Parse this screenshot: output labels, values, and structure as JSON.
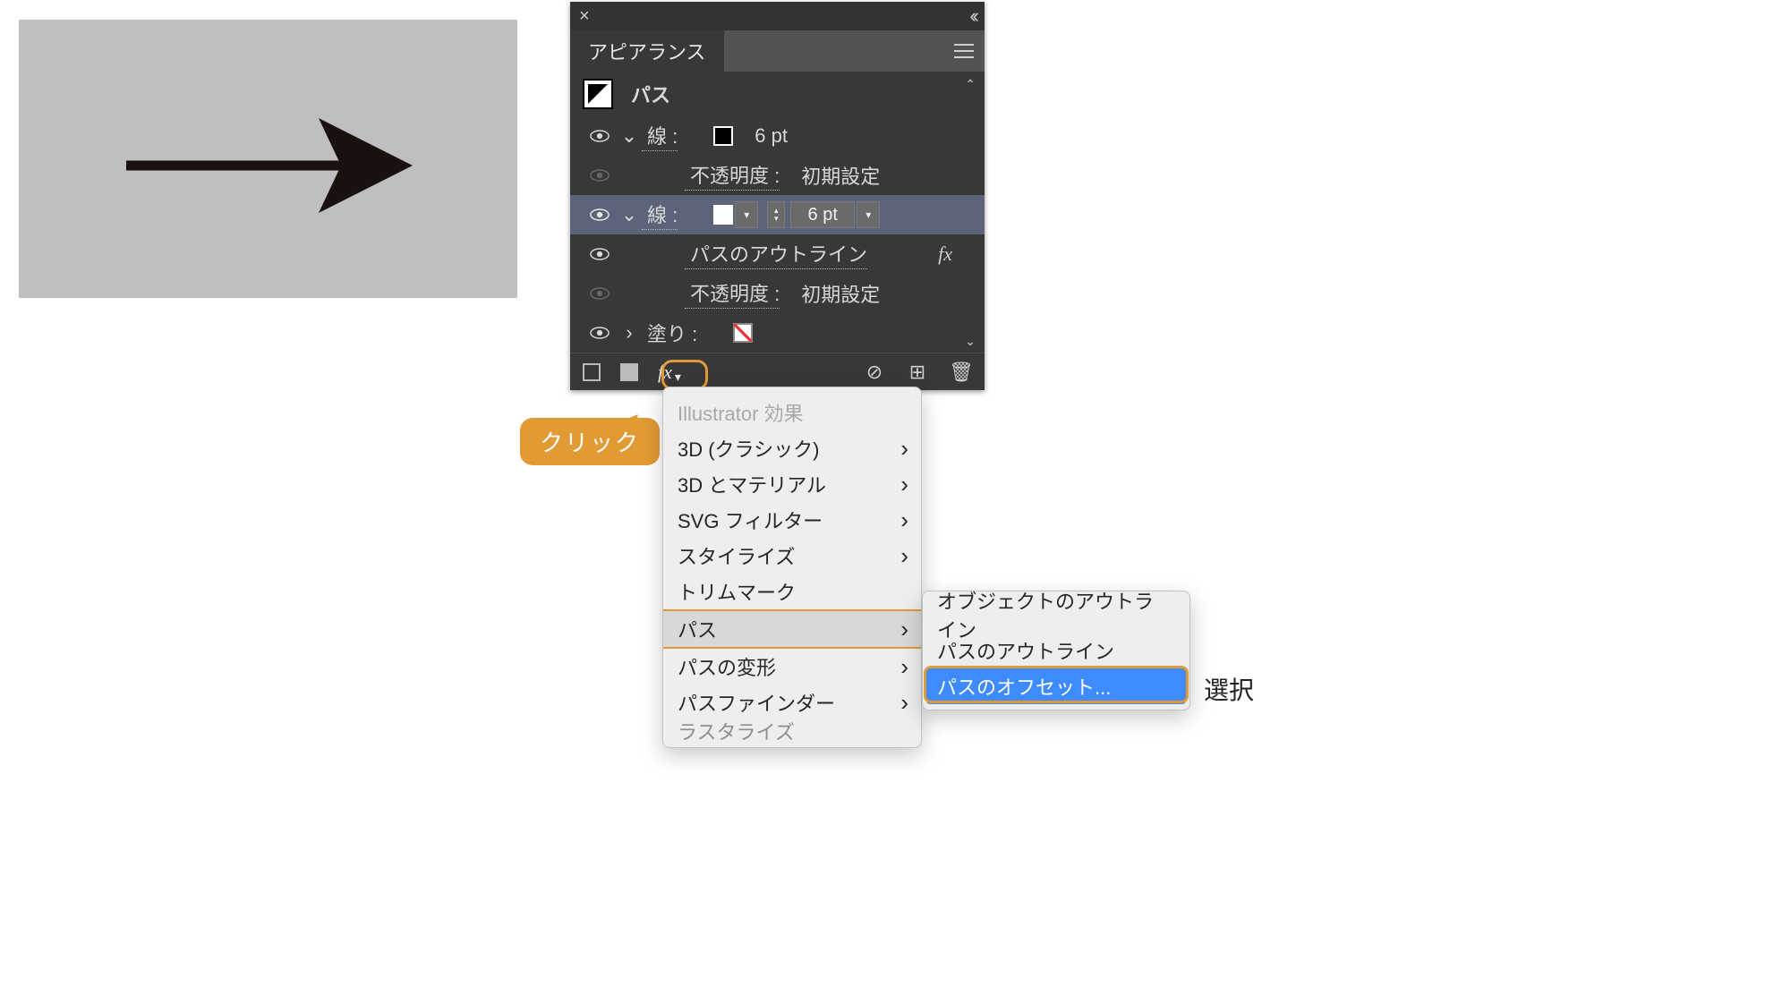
{
  "panel": {
    "title": "アピアランス",
    "object_label": "パス",
    "rows": {
      "stroke1": {
        "label": "線 :",
        "value": "6 pt"
      },
      "opacity1": {
        "label": "不透明度 :",
        "value": "初期設定"
      },
      "stroke2": {
        "label": "線 :",
        "value": "6 pt"
      },
      "outline": {
        "label": "パスのアウトライン",
        "fx": "fx"
      },
      "opacity2": {
        "label": "不透明度 :",
        "value": "初期設定"
      },
      "fill": {
        "label": "塗り :"
      }
    },
    "footer": {
      "fx": "fx"
    }
  },
  "callout": {
    "click": "クリック"
  },
  "menu": {
    "header": "Illustrator 効果",
    "items": {
      "m3dc": "3D (クラシック)",
      "m3dm": "3D とマテリアル",
      "msvg": "SVG フィルター",
      "msty": "スタイライズ",
      "mtrm": "トリムマーク",
      "mpath": "パス",
      "mwarp": "パスの変形",
      "mpf": "パスファインダー",
      "mrst": "ラスタライズ"
    }
  },
  "submenu": {
    "o1": "オブジェクトのアウトライン",
    "o2": "パスのアウトライン",
    "o3": "パスのオフセット..."
  },
  "side_label": "選択"
}
